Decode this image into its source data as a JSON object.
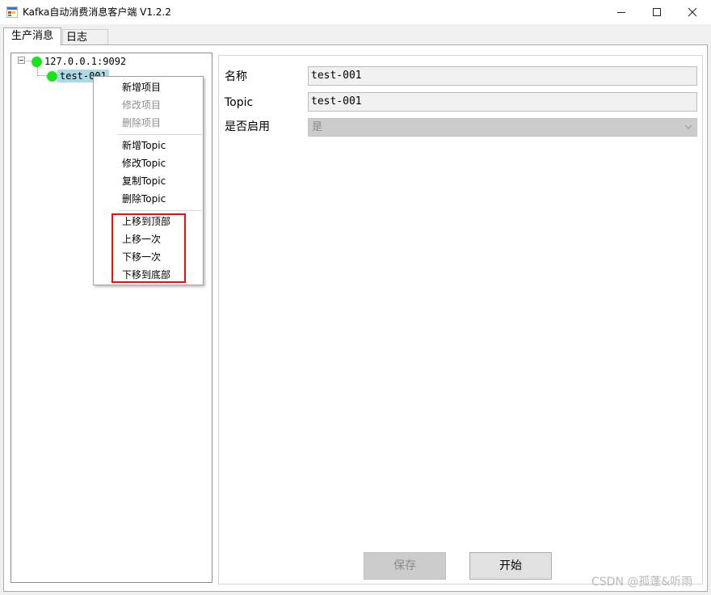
{
  "window": {
    "title": "Kafka自动消费消息客户端 V1.2.2"
  },
  "tabs": [
    {
      "label": "生产消息",
      "active": true
    },
    {
      "label": "日志",
      "active": false
    }
  ],
  "tree": {
    "root": {
      "label": "127.0.0.1:9092",
      "status_color": "#19e619"
    },
    "child": {
      "label": "test-001",
      "status_color": "#19e619",
      "selected": true
    }
  },
  "context_menu": {
    "items": [
      {
        "label": "新增项目",
        "enabled": true
      },
      {
        "label": "修改项目",
        "enabled": false
      },
      {
        "label": "删除项目",
        "enabled": false
      },
      {
        "label": "新增Topic",
        "enabled": true
      },
      {
        "label": "修改Topic",
        "enabled": true
      },
      {
        "label": "复制Topic",
        "enabled": true
      },
      {
        "label": "删除Topic",
        "enabled": true
      },
      {
        "label": "上移到顶部",
        "enabled": true
      },
      {
        "label": "上移一次",
        "enabled": true
      },
      {
        "label": "下移一次",
        "enabled": true
      },
      {
        "label": "下移到底部",
        "enabled": true
      }
    ],
    "highlight_color": "#e41313"
  },
  "form": {
    "name_label": "名称",
    "name_value": "test-001",
    "topic_label": "Topic",
    "topic_value": "test-001",
    "enabled_label": "是否启用",
    "enabled_value": "是"
  },
  "buttons": {
    "save_label": "保存",
    "start_label": "开始"
  },
  "watermark": "CSDN @孤蓬&听雨"
}
